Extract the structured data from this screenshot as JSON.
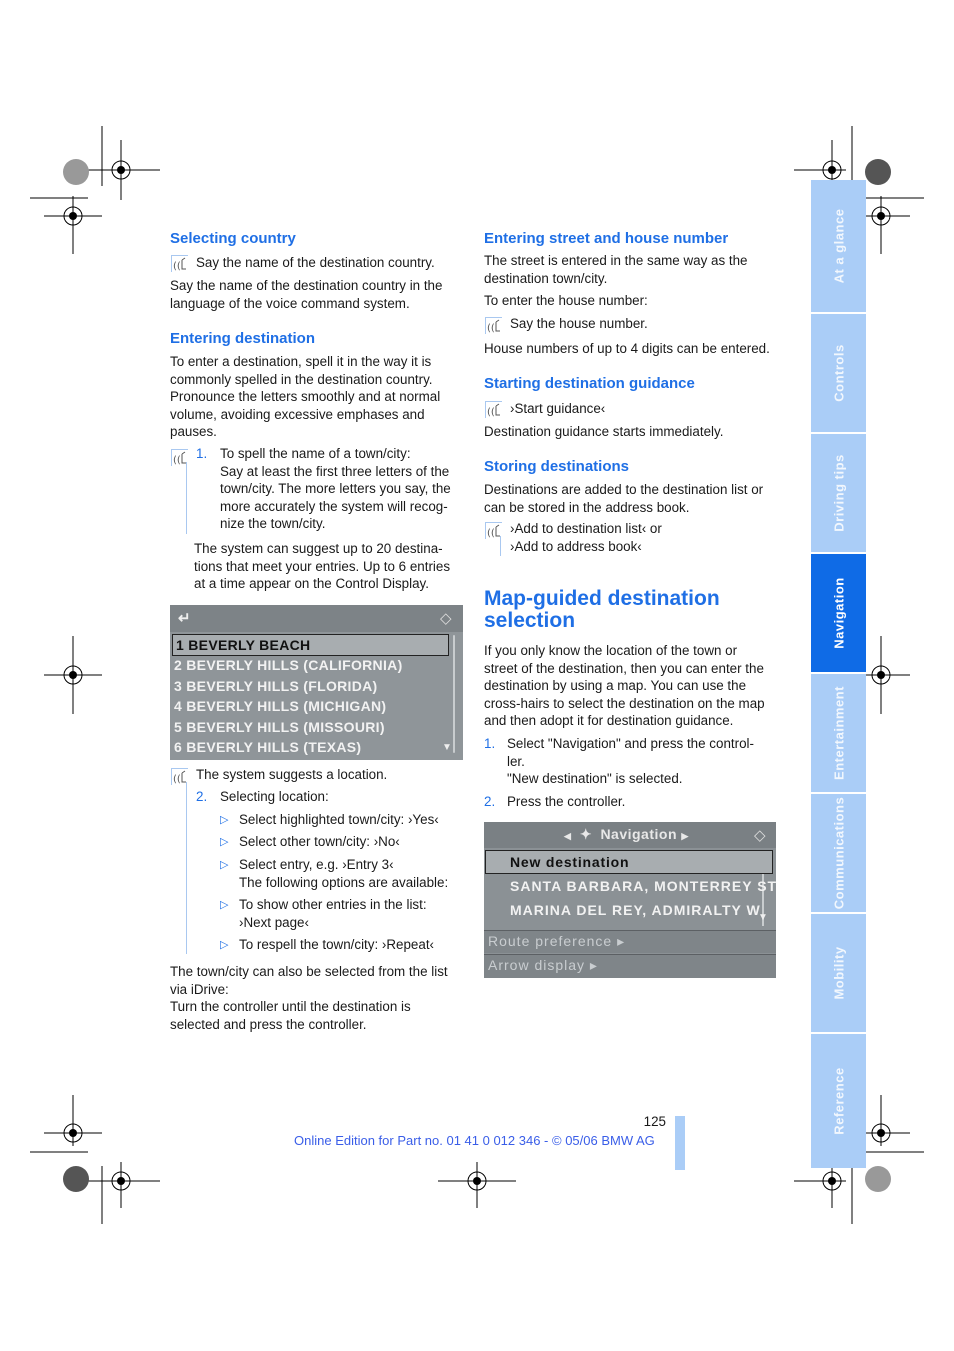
{
  "left_column": {
    "selecting_country": {
      "heading": "Selecting country",
      "voice_line": "Say the name of the destination country.",
      "body": "Say the name of the destination country in the language of the voice command system."
    },
    "entering_destination": {
      "heading": "Entering destination",
      "body_lines": [
        "To enter a destination, spell it in the way it is",
        "commonly spelled in the destination country.",
        "Pronounce the letters smoothly and at normal",
        "volume, avoiding excessive emphases and",
        "pauses."
      ],
      "step1_number": "1.",
      "step1_lines": [
        "To spell the name of a town/city:",
        "Say at least the first three letters of the",
        "town/city. The more letters you say, the",
        "more accurately the system will recog-",
        "nize the town/city."
      ],
      "suggest_lines": [
        "The system can suggest up to 20 destina-",
        "tions that meet your entries. Up to 6 entries",
        "at a time appear on the Control Display."
      ]
    },
    "screen1": {
      "back_icon": "back-arrow-icon",
      "controller_icon": "controller-icon",
      "entries": [
        "1 BEVERLY BEACH",
        "2 BEVERLY HILLS (CALIFORNIA)",
        "3 BEVERLY HILLS (FLORIDA)",
        "4 BEVERLY HILLS (MICHIGAN)",
        "5 BEVERLY HILLS (MISSOURI)",
        "6 BEVERLY HILLS (TEXAS)"
      ],
      "selected_index": 0
    },
    "system_suggests": "The system suggests a location.",
    "step2_number": "2.",
    "step2_label": "Selecting location:",
    "options": [
      {
        "lines": [
          "Select highlighted town/city: ›Yes‹"
        ]
      },
      {
        "lines": [
          "Select other town/city: ›No‹"
        ]
      },
      {
        "lines": [
          "Select entry, e.g. ›Entry 3‹",
          "The following options are available:"
        ]
      },
      {
        "lines": [
          "To show other entries in the list:",
          "›Next page‹"
        ]
      },
      {
        "lines": [
          "To respell the town/city: ›Repeat‹"
        ]
      }
    ],
    "idrive_lines": [
      "The town/city can also be selected from the list",
      "via iDrive:",
      "Turn the controller until the destination is",
      "selected and press the controller."
    ]
  },
  "right_column": {
    "street": {
      "heading": "Entering street and house number",
      "body_lines": [
        "The street is entered in the same way as the",
        "destination town/city."
      ],
      "house_intro": "To enter the house number:",
      "voice_line": "Say the house number.",
      "note": "House numbers of up to 4 digits can be entered."
    },
    "guidance": {
      "heading": "Starting destination guidance",
      "voice_line": "›Start guidance‹",
      "note": "Destination guidance starts immediately."
    },
    "storing": {
      "heading": "Storing destinations",
      "body_lines": [
        "Destinations are added to the destination list or",
        "can be stored in the address book."
      ],
      "voice_line1": "›Add to destination list‹  or",
      "voice_line2": "›Add to address book‹"
    },
    "map_guided": {
      "title_line1": "Map-guided destination",
      "title_line2": "selection",
      "body_lines": [
        "If you only know the location of the town or",
        "street of the destination, then you can enter the",
        "destination by using a map. You can use the",
        "cross-hairs to select the destination on the map",
        "and then adopt it for destination guidance."
      ],
      "step1_number": "1.",
      "step1_lines": [
        "Select \"Navigation\" and press the control-",
        "ler.",
        "\"New destination\" is selected."
      ],
      "step2_number": "2.",
      "step2_line": "Press the controller."
    },
    "screen2": {
      "title": "Navigation",
      "title_icon": "satellite-icon",
      "controller_icon": "controller-icon",
      "entries": [
        "New destination",
        "SANTA BARBARA, MONTERREY ST",
        "MARINA DEL REY, ADMIRALTY W"
      ],
      "selected_index": 0,
      "menu_items": [
        "Route preference ▸",
        "Arrow display ▸"
      ]
    }
  },
  "side_tabs": [
    {
      "label": "At a glance",
      "active": false
    },
    {
      "label": "Controls",
      "active": false
    },
    {
      "label": "Driving tips",
      "active": false
    },
    {
      "label": "Navigation",
      "active": true
    },
    {
      "label": "Entertainment",
      "active": false
    },
    {
      "label": "Communications",
      "active": false
    },
    {
      "label": "Mobility",
      "active": false
    },
    {
      "label": "Reference",
      "active": false
    }
  ],
  "footer": {
    "page_number": "125",
    "edition": "Online Edition for Part no. 01 41 0 012 346 - © 05/06 BMW AG"
  },
  "colors": {
    "heading_blue": "#1f6fe5",
    "tab_light": "#aacdf7",
    "tab_active": "#0f6be6",
    "footer_blue": "#3a5ee8"
  }
}
